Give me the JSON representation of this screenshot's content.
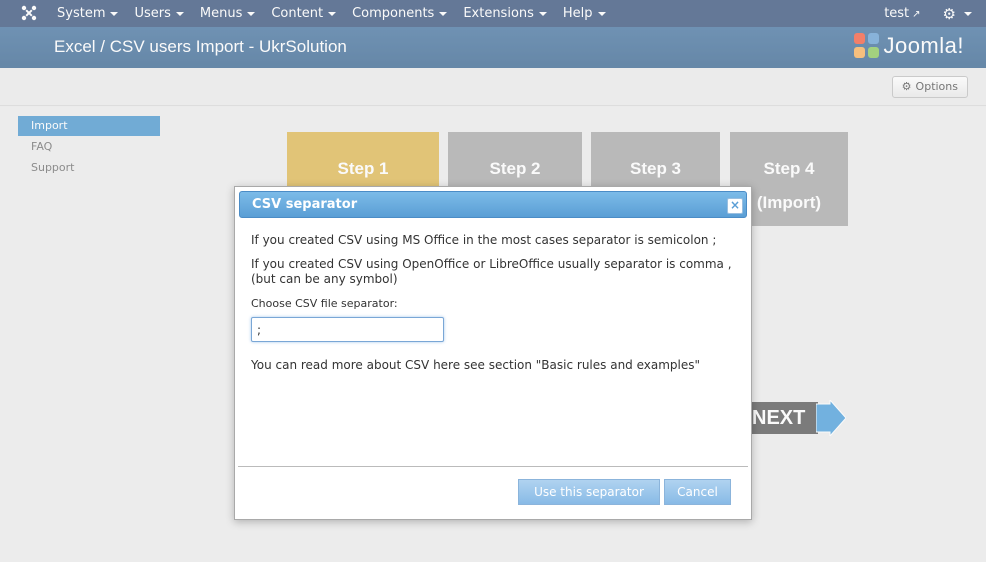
{
  "navbar": {
    "menu": [
      {
        "label": "System"
      },
      {
        "label": "Users"
      },
      {
        "label": "Menus"
      },
      {
        "label": "Content"
      },
      {
        "label": "Components"
      },
      {
        "label": "Extensions"
      },
      {
        "label": "Help"
      }
    ],
    "user": "test",
    "logo_icon": "joomla-icon",
    "settings_icon": "gear-icon"
  },
  "header": {
    "title": "Excel / CSV users Import - UkrSolution",
    "brand": "Joomla!"
  },
  "toolbar": {
    "options_label": "Options"
  },
  "sidebar": {
    "items": [
      {
        "label": "Import",
        "active": true
      },
      {
        "label": "FAQ",
        "active": false
      },
      {
        "label": "Support",
        "active": false
      }
    ]
  },
  "steps": [
    {
      "label": "Step 1",
      "sub": "",
      "active": true,
      "color": "#d9ac37"
    },
    {
      "label": "Step 2",
      "sub": "",
      "active": false,
      "color": "#9c9c9c"
    },
    {
      "label": "Step 3",
      "sub": "",
      "active": false,
      "color": "#9c9c9c"
    },
    {
      "label": "Step 4",
      "sub": "(Import)",
      "active": false,
      "color": "#9c9c9c"
    }
  ],
  "next_label": "NEXT",
  "modal": {
    "title": "CSV separator",
    "line1": "If you created CSV using MS Office in the most cases separator is semicolon ;",
    "line2": "If you created CSV using OpenOffice or LibreOffice usually separator is comma , (but can be any symbol)",
    "field_label": "Choose CSV file separator:",
    "field_value": ";",
    "more": "You can read more about CSV here see section \"Basic rules and examples\"",
    "use_label": "Use this separator",
    "cancel_label": "Cancel"
  }
}
